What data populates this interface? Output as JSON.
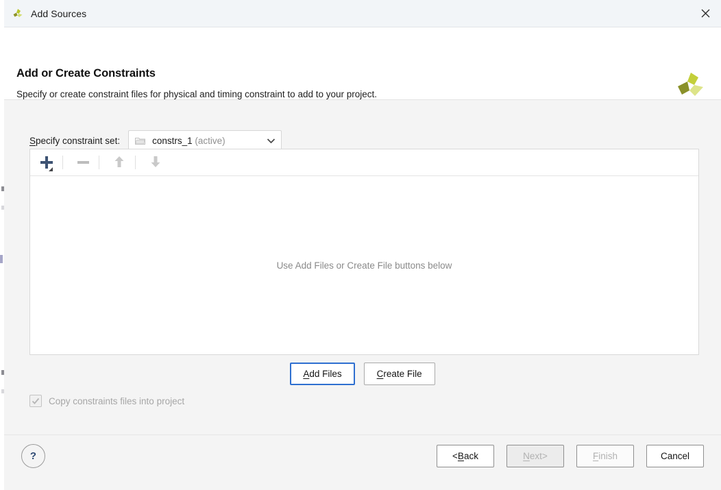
{
  "window": {
    "title": "Add Sources",
    "app_icon": "vivado-logo-icon",
    "close_label": "×"
  },
  "header": {
    "title": "Add or Create Constraints",
    "subtitle": "Specify or create constraint files for physical and timing constraint to add to your project.",
    "logo": "amd-vivado-logo-icon"
  },
  "constraint_set": {
    "label_mnemonic": "S",
    "label_rest": "pecify constraint set:",
    "folder_icon": "folder-icon",
    "value": "constrs_1",
    "state": "(active)",
    "dropdown_icon": "chevron-down-icon"
  },
  "file_panel": {
    "toolbar": {
      "add_icon": "plus-icon",
      "add_dropdown_icon": "caret-down-icon",
      "remove_icon": "minus-icon",
      "move_up_icon": "arrow-up-icon",
      "move_down_icon": "arrow-down-icon"
    },
    "empty_hint": "Use Add Files or Create File buttons below"
  },
  "actions": {
    "add_files": {
      "mnemonic": "A",
      "rest": "dd Files"
    },
    "create_file": {
      "mnemonic": "C",
      "rest": "reate File"
    }
  },
  "copy_option": {
    "checked": true,
    "enabled": false,
    "label": "Copy constraints files into project"
  },
  "footer": {
    "help_label": "?",
    "buttons": [
      {
        "prefix": "< ",
        "mnemonic": "B",
        "rest": "ack",
        "suffix": "",
        "state": "enabled"
      },
      {
        "prefix": "",
        "mnemonic": "N",
        "rest": "ext",
        "suffix": " >",
        "state": "disabled"
      },
      {
        "prefix": "",
        "mnemonic": "F",
        "rest": "inish",
        "suffix": "",
        "state": "disabled-flat"
      },
      {
        "prefix": "",
        "mnemonic": "",
        "rest": "Cancel",
        "suffix": "",
        "state": "enabled"
      }
    ]
  },
  "colors": {
    "accent_blue": "#2e6fd0",
    "plus_blue": "#3d5373",
    "logo_green": "#b5c422",
    "logo_olive": "#8a912a",
    "body_bg": "#f4f4f4",
    "titlebar_bg": "#f2f5f8"
  }
}
